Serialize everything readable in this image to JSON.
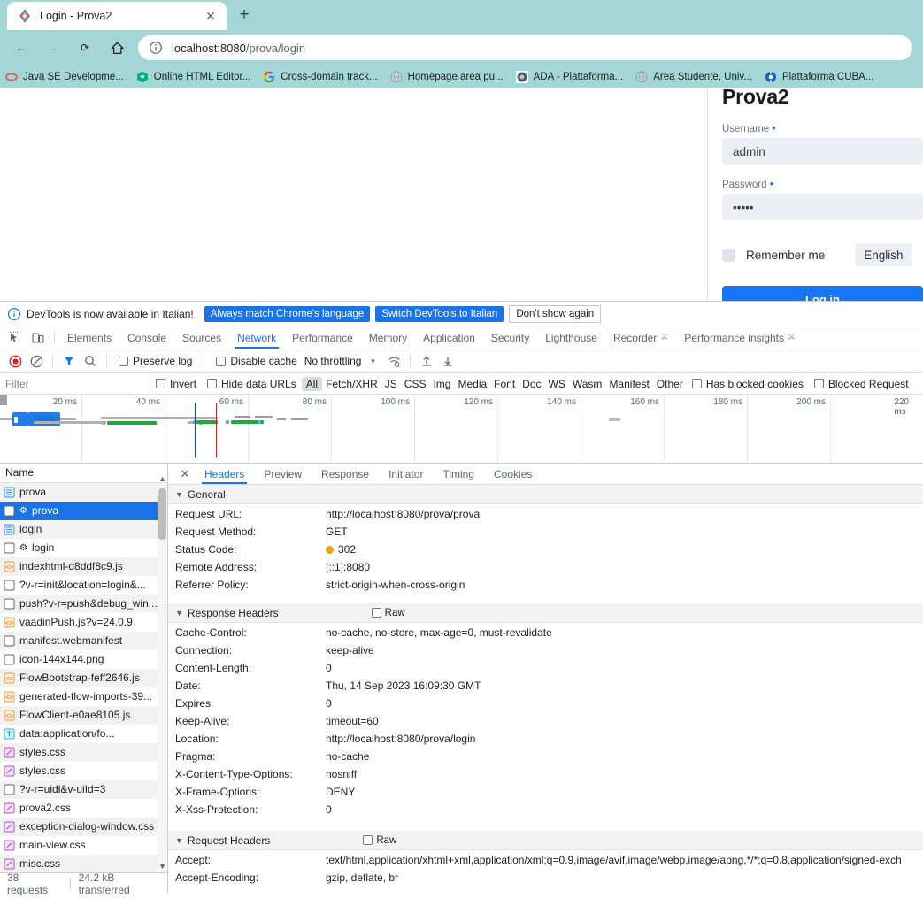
{
  "browser": {
    "tab": {
      "title": "Login - Prova2",
      "favicon": "vaadin-icon",
      "close_label": "✕"
    },
    "new_tab_label": "+",
    "nav": {
      "back": "←",
      "forward": "→",
      "reload": "⟳",
      "home": "⌂"
    },
    "omnibox": {
      "site_info_icon": "info-circle-icon",
      "url_host": "localhost:8080",
      "url_path": "/prova/login"
    },
    "bookmarks": [
      {
        "label": "Java SE Developme...",
        "icon": "oracle-icon",
        "color": "#e4543c"
      },
      {
        "label": "Online HTML Editor...",
        "icon": "html-editor-icon",
        "color": "#00b387"
      },
      {
        "label": "Cross-domain track...",
        "icon": "google-icon",
        "color": "#4285f4"
      },
      {
        "label": "Homepage area pu...",
        "icon": "globe-icon",
        "color": "#9fb3c8"
      },
      {
        "label": "ADA - Piattaforma...",
        "icon": "ada-icon",
        "color": "#2f5fa8"
      },
      {
        "label": "Area Studente, Univ...",
        "icon": "globe-icon",
        "color": "#9fb3c8"
      },
      {
        "label": "Piattaforma CUBA...",
        "icon": "cuba-icon",
        "color": "#1565c0"
      }
    ]
  },
  "page": {
    "app_title": "Prova2",
    "username": {
      "label": "Username",
      "required_mark": "•",
      "value": "admin"
    },
    "password": {
      "label": "Password",
      "required_mark": "•",
      "value": "•••••"
    },
    "remember_me": {
      "label": "Remember me",
      "checked": false
    },
    "language": {
      "value": "English"
    },
    "login_button": "Log in",
    "accent_color": "#1676f3"
  },
  "devtools": {
    "notice": {
      "text": "DevTools is now available in Italian!",
      "btn_always_match": "Always match Chrome's language",
      "btn_switch": "Switch DevTools to Italian",
      "btn_dismiss": "Don't show again"
    },
    "panels": [
      {
        "label": "Elements",
        "active": false
      },
      {
        "label": "Console",
        "active": false
      },
      {
        "label": "Sources",
        "active": false
      },
      {
        "label": "Network",
        "active": true
      },
      {
        "label": "Performance",
        "active": false
      },
      {
        "label": "Memory",
        "active": false
      },
      {
        "label": "Application",
        "active": false
      },
      {
        "label": "Security",
        "active": false
      },
      {
        "label": "Lighthouse",
        "active": false
      },
      {
        "label": "Recorder",
        "active": false,
        "experimental": true
      },
      {
        "label": "Performance insights",
        "active": false,
        "experimental": true
      }
    ],
    "toolbar": {
      "record_title": "record",
      "clear_title": "clear",
      "filter_title": "filter",
      "search_title": "search",
      "preserve_log": {
        "label": "Preserve log",
        "checked": false
      },
      "disable_cache": {
        "label": "Disable cache",
        "checked": false
      },
      "throttling": "No throttling",
      "throttling_caret": "▾",
      "wifi_title": "network-conditions",
      "import_title": "import-har",
      "export_title": "export-har"
    },
    "filterbar": {
      "placeholder": "Filter",
      "invert": {
        "label": "Invert",
        "checked": false
      },
      "hide_data_urls": {
        "label": "Hide data URLs",
        "checked": false
      },
      "types": [
        "All",
        "Fetch/XHR",
        "JS",
        "CSS",
        "Img",
        "Media",
        "Font",
        "Doc",
        "WS",
        "Wasm",
        "Manifest",
        "Other"
      ],
      "active_type": "All",
      "has_blocked_cookies": {
        "label": "Has blocked cookies",
        "checked": false
      },
      "blocked_requests": {
        "label": "Blocked Request",
        "checked": false
      }
    },
    "overview": {
      "ticks": [
        "20 ms",
        "40 ms",
        "60 ms",
        "80 ms",
        "100 ms",
        "120 ms",
        "140 ms",
        "160 ms",
        "180 ms",
        "200 ms",
        "220 ms"
      ],
      "dom_content_loaded_color": "#0d47a1",
      "load_event_color": "#c62828"
    },
    "requests": {
      "column_header": "Name",
      "rows": [
        {
          "name": "prova",
          "type": "doc",
          "selected": false
        },
        {
          "name": "prova",
          "type": "other",
          "selected": true,
          "gear": true
        },
        {
          "name": "login",
          "type": "doc",
          "selected": false
        },
        {
          "name": "login",
          "type": "other",
          "selected": false,
          "gear": true
        },
        {
          "name": "indexhtml-d8ddf8c9.js",
          "type": "js",
          "selected": false
        },
        {
          "name": "?v-r=init&location=login&...",
          "type": "other",
          "selected": false
        },
        {
          "name": "push?v-r=push&debug_win...",
          "type": "other",
          "selected": false
        },
        {
          "name": "vaadinPush.js?v=24.0.9",
          "type": "js",
          "selected": false
        },
        {
          "name": "manifest.webmanifest",
          "type": "other",
          "selected": false
        },
        {
          "name": "icon-144x144.png",
          "type": "other",
          "selected": false
        },
        {
          "name": "FlowBootstrap-feff2646.js",
          "type": "js",
          "selected": false
        },
        {
          "name": "generated-flow-imports-39...",
          "type": "js",
          "selected": false
        },
        {
          "name": "FlowClient-e0ae8105.js",
          "type": "js",
          "selected": false
        },
        {
          "name": "data:application/fo...",
          "type": "font",
          "selected": false
        },
        {
          "name": "styles.css",
          "type": "css",
          "selected": false
        },
        {
          "name": "styles.css",
          "type": "css",
          "selected": false
        },
        {
          "name": "?v-r=uidl&v-uiId=3",
          "type": "other",
          "selected": false
        },
        {
          "name": "prova2.css",
          "type": "css",
          "selected": false
        },
        {
          "name": "exception-dialog-window.css",
          "type": "css",
          "selected": false
        },
        {
          "name": "main-view.css",
          "type": "css",
          "selected": false
        },
        {
          "name": "misc.css",
          "type": "css",
          "selected": false
        }
      ],
      "status": {
        "requests": "38 requests",
        "transferred": "24.2 kB transferred"
      }
    },
    "detail": {
      "close_label": "✕",
      "tabs": [
        {
          "label": "Headers",
          "active": true
        },
        {
          "label": "Preview",
          "active": false
        },
        {
          "label": "Response",
          "active": false
        },
        {
          "label": "Initiator",
          "active": false
        },
        {
          "label": "Timing",
          "active": false
        },
        {
          "label": "Cookies",
          "active": false
        }
      ],
      "general": {
        "title": "General",
        "rows": [
          {
            "key": "Request URL:",
            "value": "http://localhost:8080/prova/prova"
          },
          {
            "key": "Request Method:",
            "value": "GET"
          },
          {
            "key": "Status Code:",
            "value": "302",
            "status_dot": "#f0a30a"
          },
          {
            "key": "Remote Address:",
            "value": "[::1]:8080"
          },
          {
            "key": "Referrer Policy:",
            "value": "strict-origin-when-cross-origin"
          }
        ]
      },
      "response_headers": {
        "title": "Response Headers",
        "raw_label": "Raw",
        "rows": [
          {
            "key": "Cache-Control:",
            "value": "no-cache, no-store, max-age=0, must-revalidate"
          },
          {
            "key": "Connection:",
            "value": "keep-alive"
          },
          {
            "key": "Content-Length:",
            "value": "0"
          },
          {
            "key": "Date:",
            "value": "Thu, 14 Sep 2023 16:09:30 GMT"
          },
          {
            "key": "Expires:",
            "value": "0"
          },
          {
            "key": "Keep-Alive:",
            "value": "timeout=60"
          },
          {
            "key": "Location:",
            "value": "http://localhost:8080/prova/login"
          },
          {
            "key": "Pragma:",
            "value": "no-cache"
          },
          {
            "key": "X-Content-Type-Options:",
            "value": "nosniff"
          },
          {
            "key": "X-Frame-Options:",
            "value": "DENY"
          },
          {
            "key": "X-Xss-Protection:",
            "value": "0"
          }
        ]
      },
      "request_headers": {
        "title": "Request Headers",
        "raw_label": "Raw",
        "rows": [
          {
            "key": "Accept:",
            "value": "text/html,application/xhtml+xml,application/xml;q=0.9,image/avif,image/webp,image/apng,*/*;q=0.8,application/signed-exch"
          },
          {
            "key": "Accept-Encoding:",
            "value": "gzip, deflate, br"
          }
        ]
      }
    }
  }
}
